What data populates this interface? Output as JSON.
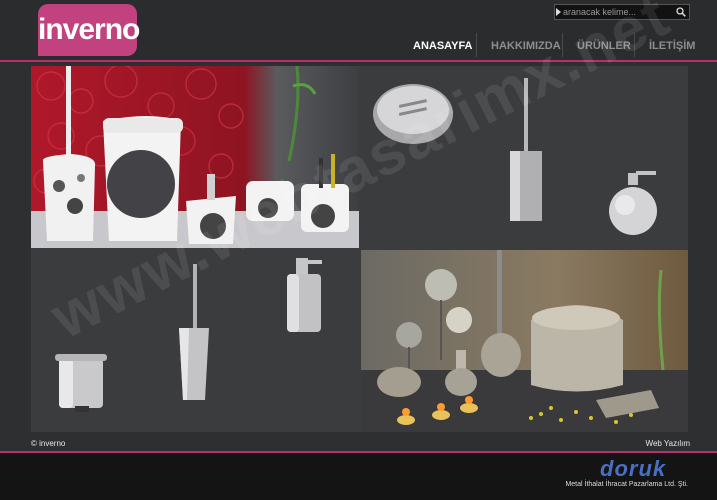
{
  "brand": {
    "logo_text": "inverno",
    "color": "#c1427f"
  },
  "search": {
    "placeholder": "aranacak kelime..."
  },
  "nav": {
    "items": [
      {
        "label": "ANASAYFA",
        "active": true
      },
      {
        "label": "HAKKIMIZDA",
        "active": false
      },
      {
        "label": "ÜRÜNLER",
        "active": false
      },
      {
        "label": "İLETİŞİM",
        "active": false
      }
    ]
  },
  "watermark": {
    "text": "www.webtasarimx.net"
  },
  "footer": {
    "copyright": "© inverno",
    "credit_link": "Web Yazılım",
    "partner_logo": "doruk",
    "partner_tagline": "Metal İthalat İhracat Pazarlama Ltd. Şti."
  },
  "colors": {
    "accent": "#b5316e",
    "background": "#2e2f31"
  }
}
